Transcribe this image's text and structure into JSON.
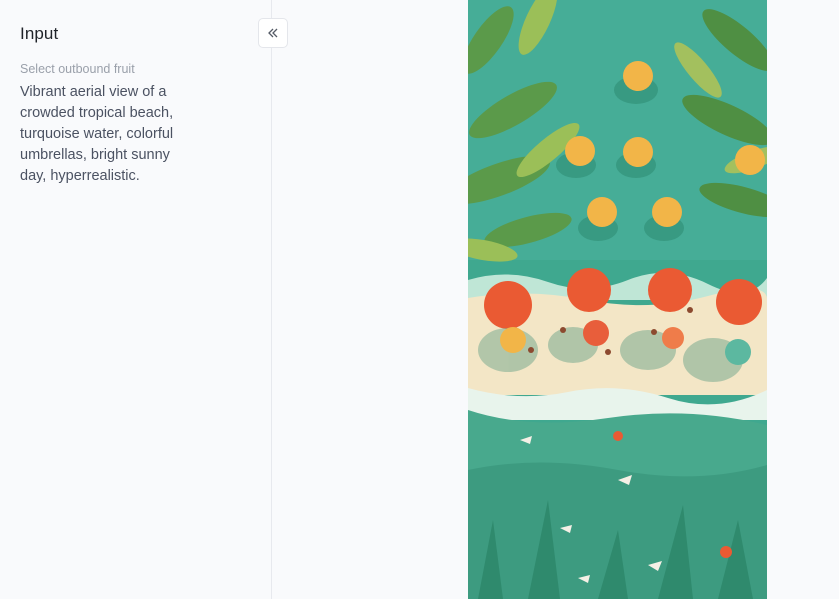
{
  "sidebar": {
    "title": "Input",
    "field_label": "Select outbound fruit",
    "prompt": "Vibrant aerial view of a crowded tropical beach, turquoise water, colorful umbrellas, bright sunny day, hyperrealistic.",
    "collapse_icon": "double-chevron-left-icon"
  },
  "result": {
    "image_description_icon": "generated-image"
  },
  "colors": {
    "background": "#f9fafc",
    "sea": "#3fa88f",
    "sand": "#f3e6c6",
    "umbrella_red": "#ea5a33",
    "umbrella_yellow": "#f2b548",
    "leaf_green": "#5b9a4a"
  }
}
